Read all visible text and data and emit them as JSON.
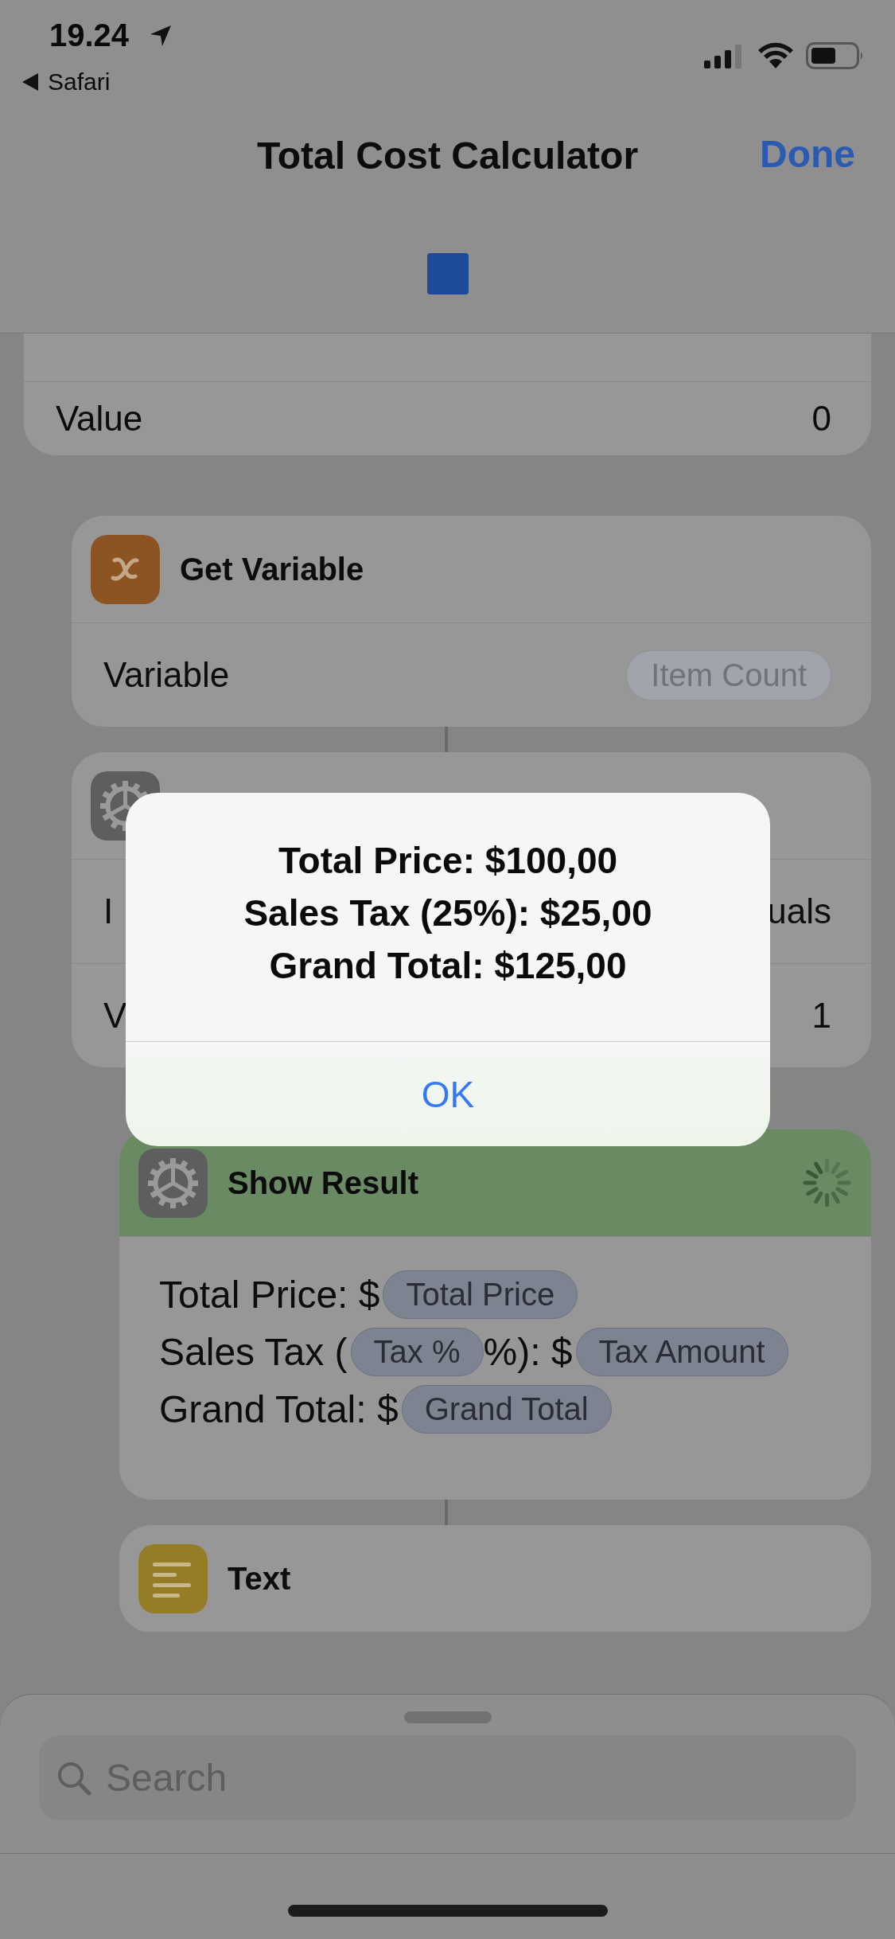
{
  "status_bar": {
    "time": "19.24",
    "back_app": "Safari"
  },
  "nav": {
    "title": "Total Cost Calculator",
    "done": "Done",
    "running": true
  },
  "actions": [
    {
      "kind": "continued",
      "rows": [
        {
          "label": "Value",
          "value": "0"
        }
      ],
      "children": [
        {
          "kind": "variable",
          "title": "Get Variable",
          "rows": [
            {
              "label": "Variable",
              "token": "Item Count"
            }
          ]
        },
        {
          "kind": "condition",
          "rows": [
            {
              "label": "I",
              "value": "uals"
            },
            {
              "label": "V",
              "value": "1"
            }
          ],
          "children": [
            {
              "kind": "show_result",
              "title": "Show Result",
              "running": true,
              "body": [
                [
                  {
                    "text": "Total Price: $"
                  },
                  {
                    "token": "Total Price"
                  }
                ],
                [
                  {
                    "text": "Sales Tax ("
                  },
                  {
                    "token": "Tax %"
                  },
                  {
                    "text": "%): $"
                  },
                  {
                    "token": "Tax Amount"
                  }
                ],
                [
                  {
                    "text": "Grand Total: $"
                  },
                  {
                    "token": "Grand Total"
                  }
                ]
              ]
            },
            {
              "kind": "text",
              "title": "Text"
            }
          ]
        }
      ]
    }
  ],
  "alert": {
    "lines": [
      "Total Price: $100,00",
      "Sales Tax (25%): $25,00",
      "Grand Total: $125,00"
    ],
    "button": "OK"
  },
  "search": {
    "placeholder": "Search"
  }
}
